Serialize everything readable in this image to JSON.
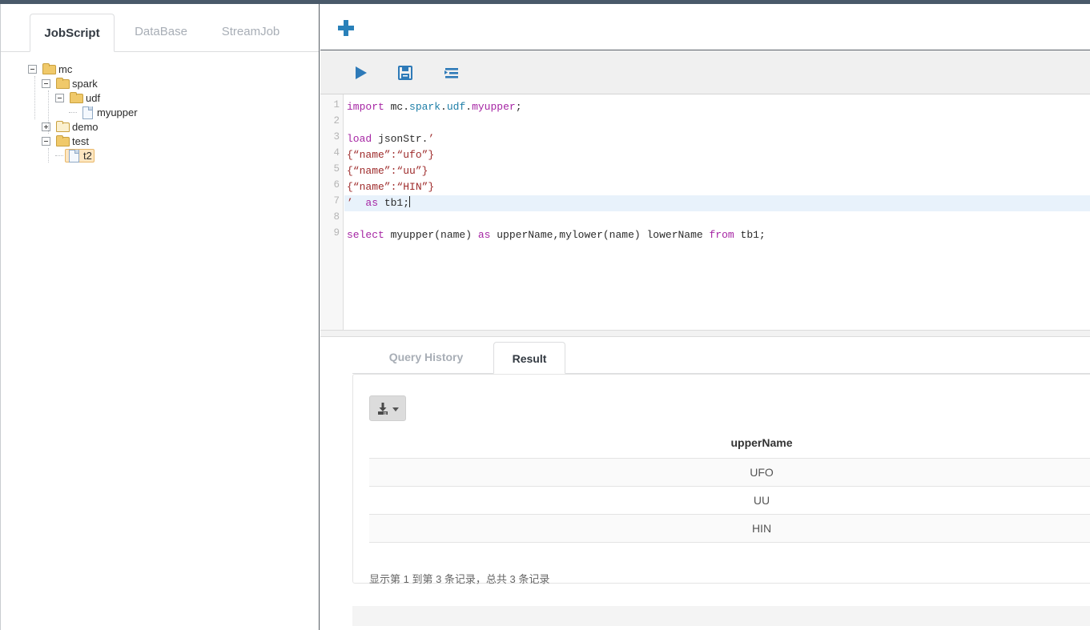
{
  "left_panel": {
    "tabs": [
      {
        "label": "JobScript",
        "active": true
      },
      {
        "label": "DataBase",
        "active": false
      },
      {
        "label": "StreamJob",
        "active": false
      }
    ],
    "tree": [
      {
        "label": "mc",
        "depth": 0,
        "type": "folder-open",
        "toggle": "minus",
        "selected": false
      },
      {
        "label": "spark",
        "depth": 1,
        "type": "folder-open",
        "toggle": "minus",
        "selected": false
      },
      {
        "label": "udf",
        "depth": 2,
        "type": "folder-open",
        "toggle": "minus",
        "selected": false
      },
      {
        "label": "myupper",
        "depth": 3,
        "type": "file",
        "toggle": "none",
        "selected": false
      },
      {
        "label": "demo",
        "depth": 1,
        "type": "folder-closed",
        "toggle": "plus",
        "selected": false
      },
      {
        "label": "test",
        "depth": 1,
        "type": "folder-open",
        "toggle": "minus",
        "selected": false
      },
      {
        "label": "t2",
        "depth": 2,
        "type": "file",
        "toggle": "none",
        "selected": true
      }
    ]
  },
  "editor": {
    "add_tab_label": "+",
    "toolbar": {
      "run_label": "Run",
      "save_label": "Save",
      "format_label": "Format"
    },
    "lines": [
      {
        "n": "1",
        "active": false,
        "tokens": [
          {
            "t": "import",
            "c": "kw"
          },
          {
            "t": " mc.",
            "c": ""
          },
          {
            "t": "spark",
            "c": "pkg"
          },
          {
            "t": ".",
            "c": ""
          },
          {
            "t": "udf",
            "c": "pkg"
          },
          {
            "t": ".",
            "c": ""
          },
          {
            "t": "myupper",
            "c": "kw"
          },
          {
            "t": ";",
            "c": ""
          }
        ]
      },
      {
        "n": "2",
        "active": false,
        "tokens": []
      },
      {
        "n": "3",
        "active": false,
        "tokens": [
          {
            "t": "load",
            "c": "kw"
          },
          {
            "t": " jsonStr.",
            "c": ""
          },
          {
            "t": "’",
            "c": "str"
          }
        ]
      },
      {
        "n": "4",
        "active": false,
        "tokens": [
          {
            "t": "{“name”:“ufo”}",
            "c": "str"
          }
        ]
      },
      {
        "n": "5",
        "active": false,
        "tokens": [
          {
            "t": "{“name”:“uu”}",
            "c": "str"
          }
        ]
      },
      {
        "n": "6",
        "active": false,
        "tokens": [
          {
            "t": "{“name”:“HIN”}",
            "c": "str"
          }
        ]
      },
      {
        "n": "7",
        "active": true,
        "caret": true,
        "tokens": [
          {
            "t": "’",
            "c": "str"
          },
          {
            "t": "  ",
            "c": ""
          },
          {
            "t": "as",
            "c": "kw"
          },
          {
            "t": " tb1;",
            "c": ""
          }
        ]
      },
      {
        "n": "8",
        "active": false,
        "tokens": []
      },
      {
        "n": "9",
        "active": false,
        "tokens": [
          {
            "t": "select",
            "c": "kw"
          },
          {
            "t": " myupper(name) ",
            "c": ""
          },
          {
            "t": "as",
            "c": "kw"
          },
          {
            "t": " upperName,mylower(name) lowerName ",
            "c": ""
          },
          {
            "t": "from",
            "c": "kw"
          },
          {
            "t": " tb1;",
            "c": ""
          }
        ]
      }
    ]
  },
  "result": {
    "tabs": [
      {
        "label": "Query History",
        "active": false
      },
      {
        "label": "Result",
        "active": true
      }
    ],
    "download_label": "Download",
    "table": {
      "columns": [
        "upperName"
      ],
      "rows": [
        [
          "UFO"
        ],
        [
          "UU"
        ],
        [
          "HIN"
        ]
      ]
    },
    "info_text": "显示第 1 到第 3 条记录，总共 3 条记录"
  },
  "colors": {
    "topbar": "#4a5a6a",
    "accent": "#2980b9",
    "keyword": "#a626a4",
    "package": "#1f7fa8",
    "string": "#9e2b2b",
    "active_line": "#e8f2fb",
    "selected_node": "#fde6c1"
  }
}
